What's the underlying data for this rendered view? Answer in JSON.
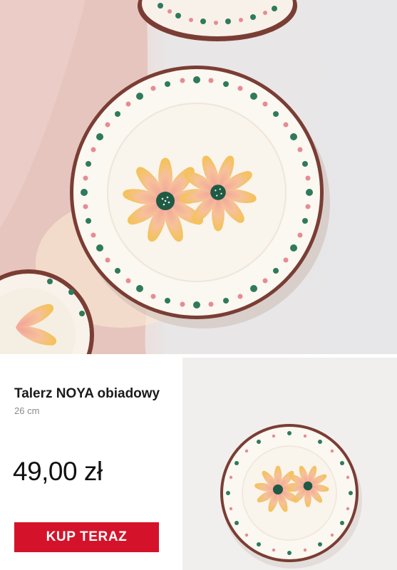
{
  "product": {
    "name": "Talerz NOYA obiadowy",
    "size": "26 cm",
    "price": "49,00 zł",
    "buy_label": "KUP TERAZ"
  },
  "icons": {
    "hero": "plate-photo",
    "thumbnail": "plate-thumbnail"
  },
  "colors": {
    "accent": "#d4132a",
    "text": "#1b1b1b",
    "muted": "#8a8a8a",
    "thumb_bg": "#f1efee"
  }
}
